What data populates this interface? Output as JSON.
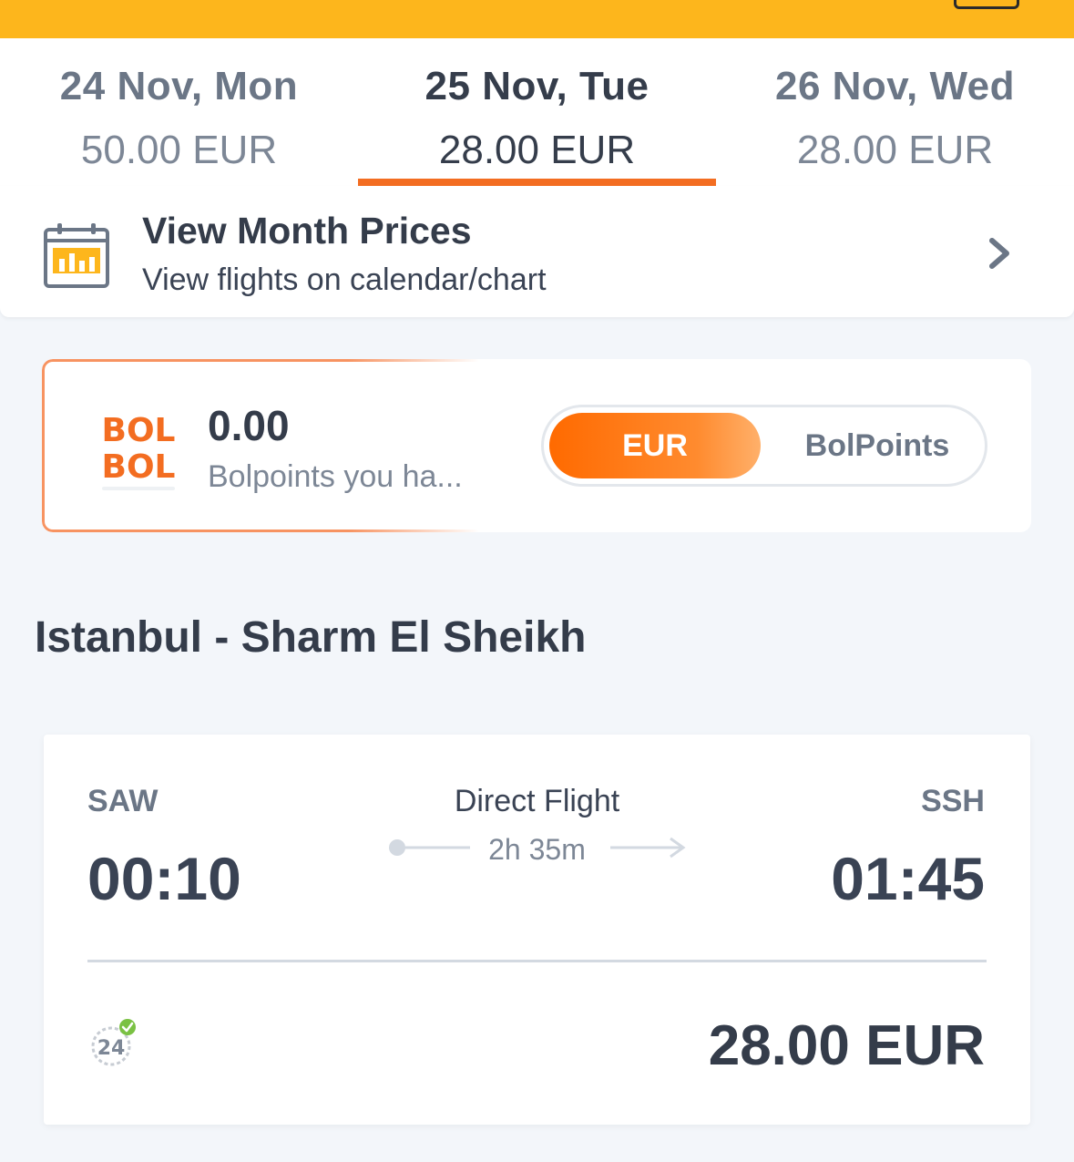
{
  "header": {
    "background_color": "#fdb61c"
  },
  "date_tabs": [
    {
      "date": "24 Nov, Mon",
      "price": "50.00 EUR",
      "active": false
    },
    {
      "date": "25 Nov, Tue",
      "price": "28.00 EUR",
      "active": true
    },
    {
      "date": "26 Nov, Wed",
      "price": "28.00 EUR",
      "active": false
    }
  ],
  "month_prices": {
    "title": "View Month Prices",
    "subtitle": "View flights on calendar/chart",
    "icon": "calendar-chart-icon"
  },
  "bolpoints": {
    "logo_text": [
      "BOL",
      "BOL"
    ],
    "value": "0.00",
    "subtitle": "Bolpoints you ha...",
    "toggle": {
      "options": [
        "EUR",
        "BolPoints"
      ],
      "selected": "EUR"
    }
  },
  "route": {
    "title": "Istanbul - Sharm El Sheikh"
  },
  "flight": {
    "origin_code": "SAW",
    "destination_code": "SSH",
    "departure_time": "00:10",
    "arrival_time": "01:45",
    "flight_type": "Direct Flight",
    "duration": "2h 35m",
    "badge_text": "24",
    "price": "28.00 EUR"
  },
  "colors": {
    "accent_orange": "#f36d21",
    "text_dark": "#343c4a",
    "text_muted": "#7d8796",
    "check_green": "#7ac143"
  }
}
